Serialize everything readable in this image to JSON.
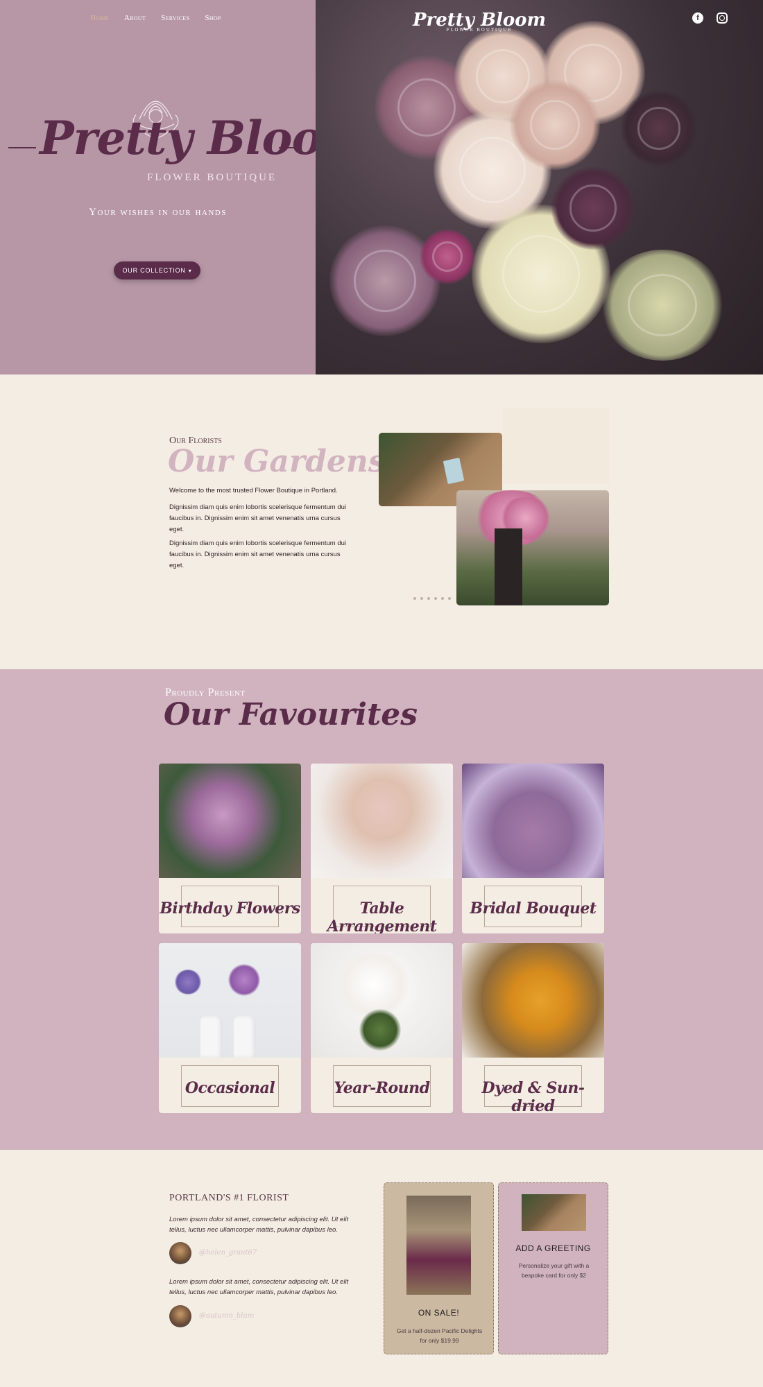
{
  "nav": {
    "items": [
      {
        "label": "Home",
        "active": true
      },
      {
        "label": "About",
        "active": false
      },
      {
        "label": "Services",
        "active": false
      },
      {
        "label": "Shop",
        "active": false
      }
    ]
  },
  "hero": {
    "logo": "Pretty Bloom",
    "logo_sub": "FLOWER BOUTIQUE",
    "tagline": "Your wishes in our hands",
    "cta_label": "OUR COLLECTION",
    "right_logo": "Pretty Bloom",
    "right_logo_sub": "FLOWER BOUTIQUE"
  },
  "social": {
    "facebook_icon": "facebook-icon",
    "instagram_icon": "instagram-icon"
  },
  "gardens": {
    "overline": "Our Florists",
    "title": "Our Gardens",
    "paragraphs": [
      "Welcome to the most trusted Flower Boutique in Portland.",
      "Dignissim diam quis enim lobortis scelerisque fermentum dui faucibus in. Dignissim enim sit amet venenatis urna cursus eget.",
      "Dignissim diam quis enim lobortis scelerisque fermentum dui faucibus in. Dignissim enim sit amet venenatis urna cursus eget."
    ]
  },
  "favourites": {
    "overline": "Proudly Present",
    "title": "Our Favourites",
    "cards": [
      {
        "label": "Birthday Flowers"
      },
      {
        "label": "Table Arrangement"
      },
      {
        "label": "Bridal Bouquet"
      },
      {
        "label": "Occasional"
      },
      {
        "label": "Year-Round"
      },
      {
        "label": "Dyed & Sun-dried"
      }
    ]
  },
  "testimonials": {
    "heading": "PORTLAND'S #1 FLORIST",
    "items": [
      {
        "quote": "Lorem ipsum dolor sit amet, consectetur adipiscing elit. Ut elit tellus, luctus nec ullamcorper mattis, pulvinar dapibus leo.",
        "handle": "@helen_grant67"
      },
      {
        "quote": "Lorem ipsum dolor sit amet, consectetur adipiscing elit. Ut elit tellus, luctus nec ullamcorper mattis, pulvinar dapibus leo.",
        "handle": "@autumn_blum"
      }
    ]
  },
  "promos": [
    {
      "title": "ON SALE!",
      "text": "Get a half-dozen Pacific Delights for only $19.99"
    },
    {
      "title": "ADD A GREETING",
      "text": "Personalize your gift with a bespoke card for only $2"
    }
  ],
  "colors": {
    "plum": "#5a2c4a",
    "mauve": "#b797a6",
    "pink": "#d0b3be",
    "cream": "#f4ede3",
    "sand": "#cbb9a2"
  }
}
